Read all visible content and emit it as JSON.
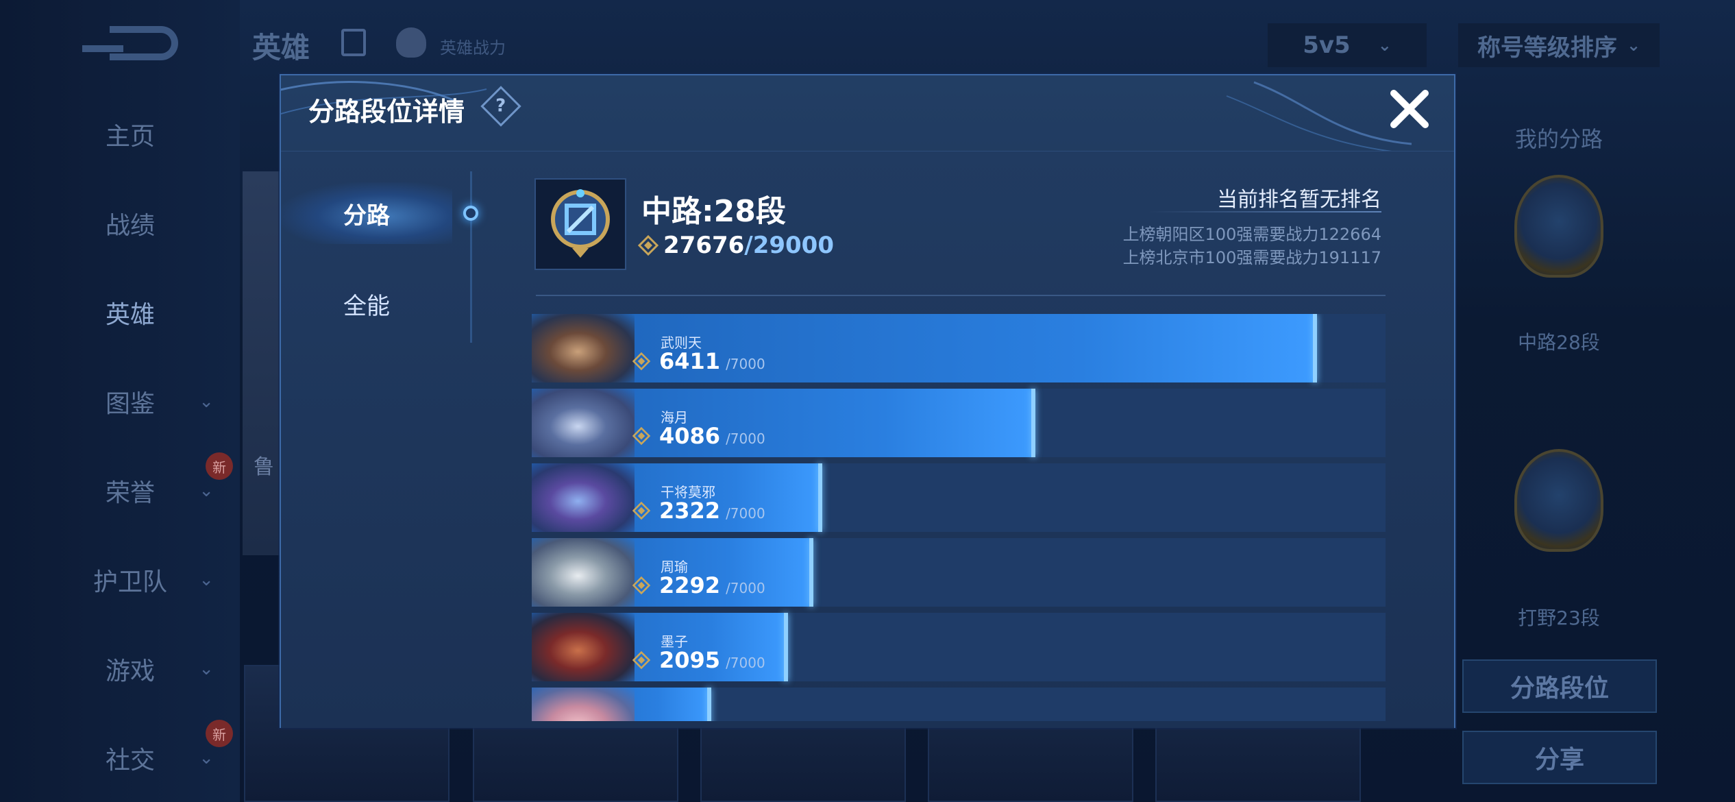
{
  "background": {
    "header": {
      "title": "英雄",
      "subtitle": "英雄战力",
      "mode": "5v5",
      "sort": "称号等级排序"
    },
    "sidebar": {
      "items": [
        {
          "label": "主页",
          "has_chevron": false
        },
        {
          "label": "战绩",
          "has_chevron": false
        },
        {
          "label": "英雄",
          "has_chevron": false
        },
        {
          "label": "图鉴",
          "has_chevron": true
        },
        {
          "label": "荣誉",
          "has_chevron": true,
          "badge": "新"
        },
        {
          "label": "护卫队",
          "has_chevron": true
        },
        {
          "label": "游戏",
          "has_chevron": true
        },
        {
          "label": "社交",
          "has_chevron": true,
          "badge": "新"
        }
      ],
      "active_index": 2
    },
    "right_panel": {
      "title": "我的分路",
      "lanes": [
        {
          "label": "中路28段"
        },
        {
          "label": "打野23段"
        }
      ],
      "lane_button": "分路段位",
      "share_button": "分享"
    },
    "hero_card_label": "鲁"
  },
  "modal": {
    "title": "分路段位详情",
    "help_icon": "?",
    "tabs": [
      {
        "label": "分路",
        "active": true
      },
      {
        "label": "全能",
        "active": false
      }
    ],
    "lane": {
      "title": "中路:28段",
      "power_current": "27676",
      "power_max": "/29000",
      "rank_status": "当前排名暂无排名",
      "rank_requirements": [
        "上榜朝阳区100强需要战力122664",
        "上榜北京市100强需要战力191117"
      ]
    },
    "heroes": [
      {
        "name": "武则天",
        "score": "6411",
        "max": "/7000",
        "progress": 0.92
      },
      {
        "name": "海月",
        "score": "4086",
        "max": "/7000",
        "progress": 0.59
      },
      {
        "name": "干将莫邪",
        "score": "2322",
        "max": "/7000",
        "progress": 0.34
      },
      {
        "name": "周瑜",
        "score": "2292",
        "max": "/7000",
        "progress": 0.33
      },
      {
        "name": "墨子",
        "score": "2095",
        "max": "/7000",
        "progress": 0.3
      },
      {
        "name": "",
        "score": "",
        "max": "",
        "progress": 0.21
      }
    ]
  },
  "colors": {
    "accent": "#2a7fe0",
    "bar_track": "#1f3c68",
    "bar_edge": "#8fd0ff",
    "power_max": "#8ec6ff",
    "gold": "#c9a65a"
  }
}
